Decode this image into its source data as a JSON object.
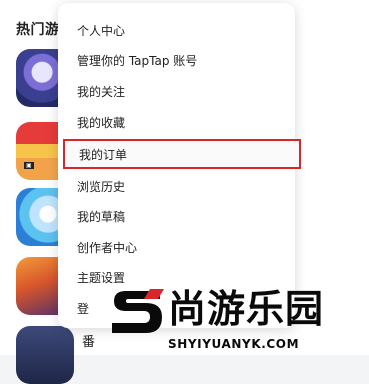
{
  "background": {
    "section_title": "热门游",
    "bottom_row_text": "番"
  },
  "menu": {
    "items": [
      {
        "label": "个人中心"
      },
      {
        "label": "管理你的 TapTap 账号"
      },
      {
        "label": "我的关注"
      },
      {
        "label": "我的收藏"
      },
      {
        "label": "我的订单",
        "highlighted": true
      },
      {
        "label": "浏览历史"
      },
      {
        "label": "我的草稿"
      },
      {
        "label": "创作者中心"
      },
      {
        "label": "主题设置"
      },
      {
        "label": "登"
      }
    ]
  },
  "watermark": {
    "title": "尚游乐园",
    "url": "SHYIYUANYK.COM",
    "colors": {
      "accent": "#d9262b",
      "dark": "#0a0a0a"
    }
  },
  "colors": {
    "highlight_border": "#d9262b",
    "text": "#222222"
  }
}
